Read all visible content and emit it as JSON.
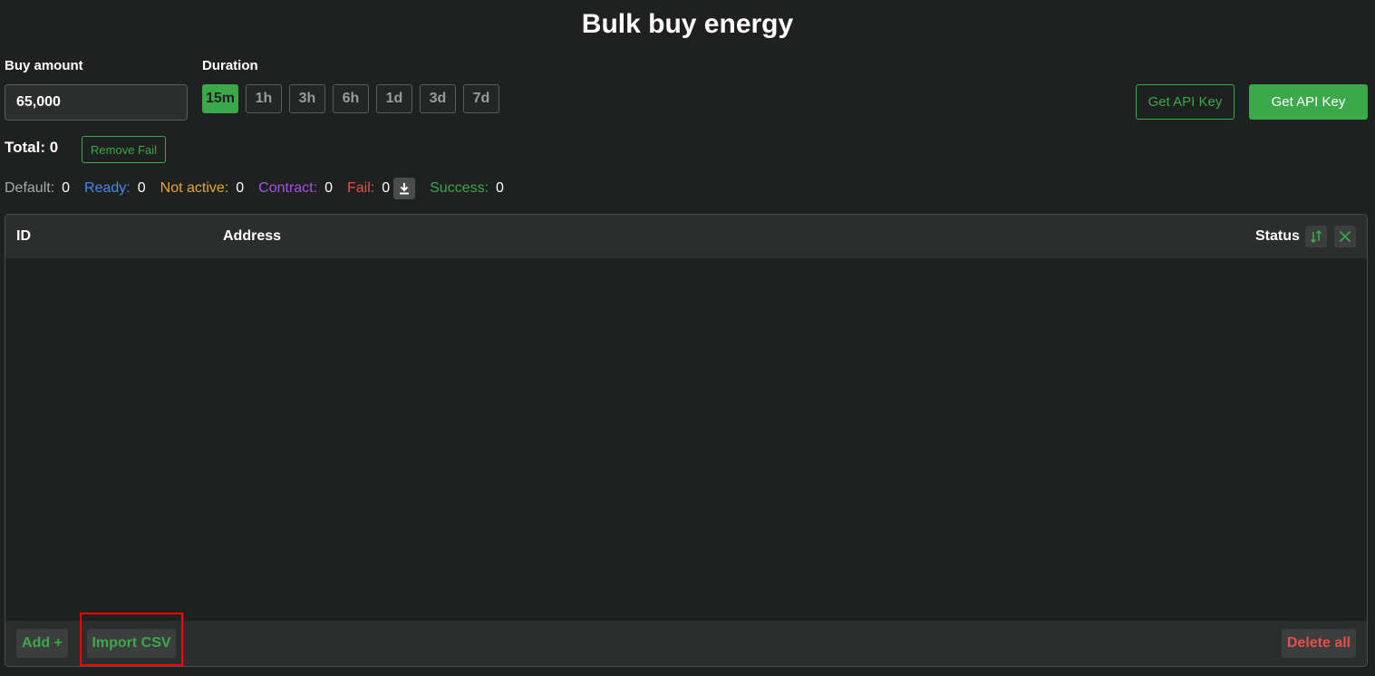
{
  "header": {
    "title": "Bulk buy energy"
  },
  "buy_amount": {
    "label": "Buy amount",
    "value": "65,000"
  },
  "duration": {
    "label": "Duration",
    "options": [
      "15m",
      "1h",
      "3h",
      "6h",
      "1d",
      "3d",
      "7d"
    ],
    "selected": "15m"
  },
  "api": {
    "outline_label": "Get API Key",
    "solid_label": "Get API Key"
  },
  "total": {
    "label": "Total: 0"
  },
  "remove_fail": {
    "label": "Remove Fail"
  },
  "stats": {
    "default": {
      "label": "Default:",
      "value": "0"
    },
    "ready": {
      "label": "Ready:",
      "value": "0"
    },
    "not_active": {
      "label": "Not active:",
      "value": "0"
    },
    "contract": {
      "label": "Contract:",
      "value": "0"
    },
    "fail": {
      "label": "Fail:",
      "value": "0"
    },
    "success": {
      "label": "Success:",
      "value": "0"
    }
  },
  "table": {
    "columns": {
      "id": "ID",
      "address": "Address",
      "status": "Status"
    },
    "rows": []
  },
  "footer": {
    "add_label": "Add +",
    "import_label": "Import CSV",
    "delete_label": "Delete all"
  },
  "colors": {
    "accent": "#3ba84a",
    "danger": "#e34f4f",
    "ready": "#4a86e8",
    "not_active": "#e6a72a",
    "contract": "#a454e8",
    "background": "#1e211f"
  }
}
